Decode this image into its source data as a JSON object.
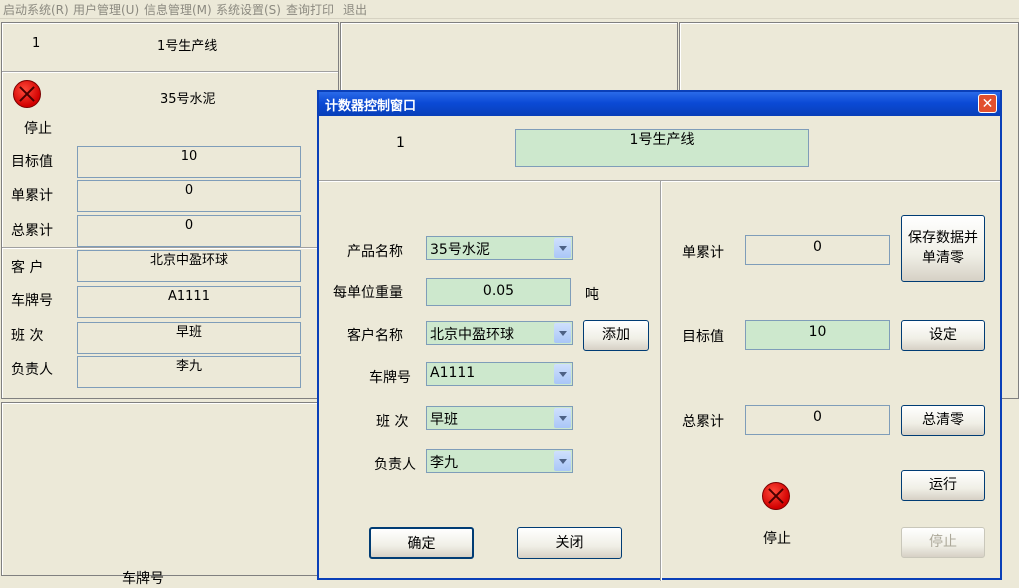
{
  "menu": [
    "启动系统(R)",
    "用户管理(U)",
    "信息管理(M)",
    "系统设置(S)",
    "查询打印",
    "退出"
  ],
  "panel": {
    "number": "1",
    "line_name": "1号生产线",
    "product": "35号水泥",
    "status": "停止",
    "rows": [
      {
        "label": "目标值",
        "value": "10"
      },
      {
        "label": "单累计",
        "value": "0"
      },
      {
        "label": "总累计",
        "value": "0"
      },
      {
        "label": "客 户",
        "value": "北京中盈环球"
      },
      {
        "label": "车牌号",
        "value": "A1111"
      },
      {
        "label": "班 次",
        "value": "早班"
      },
      {
        "label": "负责人",
        "value": "李九"
      }
    ],
    "bottom_partial_text": "车牌号"
  },
  "dialog": {
    "title": "计数器控制窗口",
    "close_glyph": "✕",
    "number": "1",
    "line_name": "1号生产线",
    "product_label": "产品名称",
    "product_value": "35号水泥",
    "unit_weight_label": "每单位重量",
    "unit_weight_value": "0.05",
    "unit": "吨",
    "customer_label": "客户名称",
    "customer_value": "北京中盈环球",
    "add_button": "添加",
    "plate_label": "车牌号",
    "plate_value": "A1111",
    "shift_label": "班 次",
    "shift_value": "早班",
    "manager_label": "负责人",
    "manager_value": "李九",
    "ok_button": "确定",
    "close_button": "关闭",
    "single_total_label": "单累计",
    "single_total_value": "0",
    "save_clear_button": "保存数据并单清零",
    "target_label": "目标值",
    "target_value": "10",
    "set_button": "设定",
    "total_label": "总累计",
    "total_value": "0",
    "total_clear_button": "总清零",
    "run_button": "运行",
    "status": "停止",
    "stop_button": "停止",
    "accent_green": "#cde8cd",
    "titlebar_blue": "#0b4ad6"
  }
}
